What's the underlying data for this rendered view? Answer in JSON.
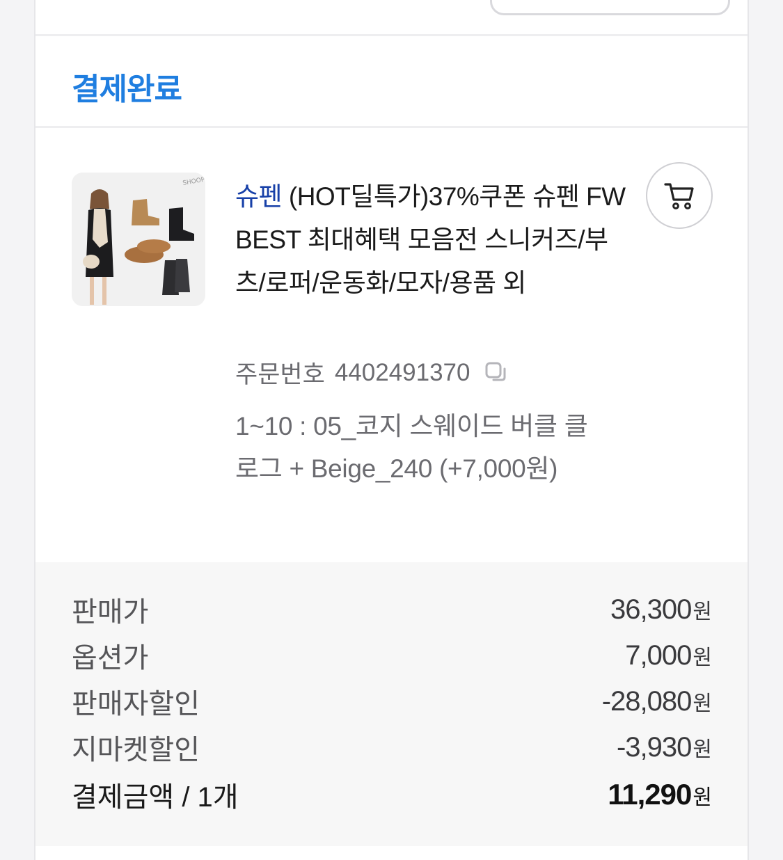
{
  "status": "결제완료",
  "product": {
    "brand": "슈펜",
    "title_rest": " (HOT딜특가)37%쿠폰 슈펜 FW BEST 최대혜택 모음전 스니커즈/부츠/로퍼/운동화/모자/용품 외",
    "thumbnail_icon": "product-thumbnail"
  },
  "order": {
    "label": "주문번호",
    "number": "4402491370"
  },
  "option_text": "1~10 : 05_코지 스웨이드 버클 클로그 + Beige_240 (+7,000원)",
  "summary": [
    {
      "label": "판매가",
      "value": "36,300",
      "unit": "원"
    },
    {
      "label": "옵션가",
      "value": "7,000",
      "unit": "원"
    },
    {
      "label": "판매자할인",
      "value": "-28,080",
      "unit": "원"
    },
    {
      "label": "지마켓할인",
      "value": "-3,930",
      "unit": "원"
    },
    {
      "label": "결제금액 / 1개",
      "value": "11,290",
      "unit": "원"
    }
  ],
  "colors": {
    "status": "#1f7ee0",
    "brand": "#1740a8"
  }
}
